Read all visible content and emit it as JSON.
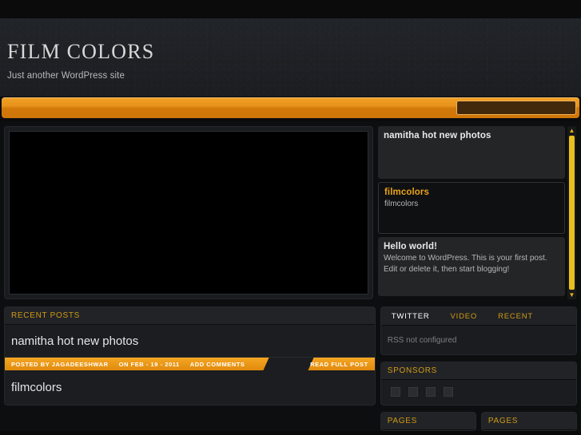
{
  "colors": {
    "accent_orange": "#e8921c",
    "gold": "#d19a16",
    "scrollbar_yellow": "#e8c01e",
    "page_bg": "#0d0e10",
    "panel_bg": "#191b1e"
  },
  "header": {
    "title": "FILM COLORS",
    "tagline": "Just another WordPress site"
  },
  "nav": {
    "items": [],
    "search": {
      "value": "",
      "placeholder": ""
    }
  },
  "featured": {
    "slider_alt": "featured-slider-stage",
    "items": [
      {
        "title": "namitha hot new photos",
        "excerpt": "",
        "active": false
      },
      {
        "title": "filmcolors",
        "excerpt": "filmcolors",
        "active": true
      },
      {
        "title": "Hello world!",
        "excerpt": "Welcome to WordPress. This is your first post. Edit or delete it, then start blogging!",
        "active": false
      }
    ],
    "scrollbar": {
      "up_glyph": "▲",
      "down_glyph": "▼"
    }
  },
  "recent_posts": {
    "heading": "RECENT POSTS",
    "posts": [
      {
        "title": "namitha hot new photos",
        "meta": {
          "author": "POSTED BY JAGADEESHWAR",
          "date": "ON FEB - 19 - 2011",
          "comments": "ADD COMMENTS",
          "read_more": "READ FULL POST"
        }
      },
      {
        "title": "filmcolors"
      }
    ]
  },
  "sidebar": {
    "tabs": [
      {
        "label": "TWITTER",
        "active": true
      },
      {
        "label": "VIDEO",
        "active": false
      },
      {
        "label": "RECENT",
        "active": false
      }
    ],
    "tab_body_text": "RSS not configured",
    "sponsors": {
      "heading": "SPONSORS",
      "thumbs": [
        "sponsor-1",
        "sponsor-2",
        "sponsor-3",
        "sponsor-4"
      ]
    },
    "pages_left": {
      "heading": "PAGES"
    },
    "pages_right": {
      "heading": "PAGES"
    }
  }
}
